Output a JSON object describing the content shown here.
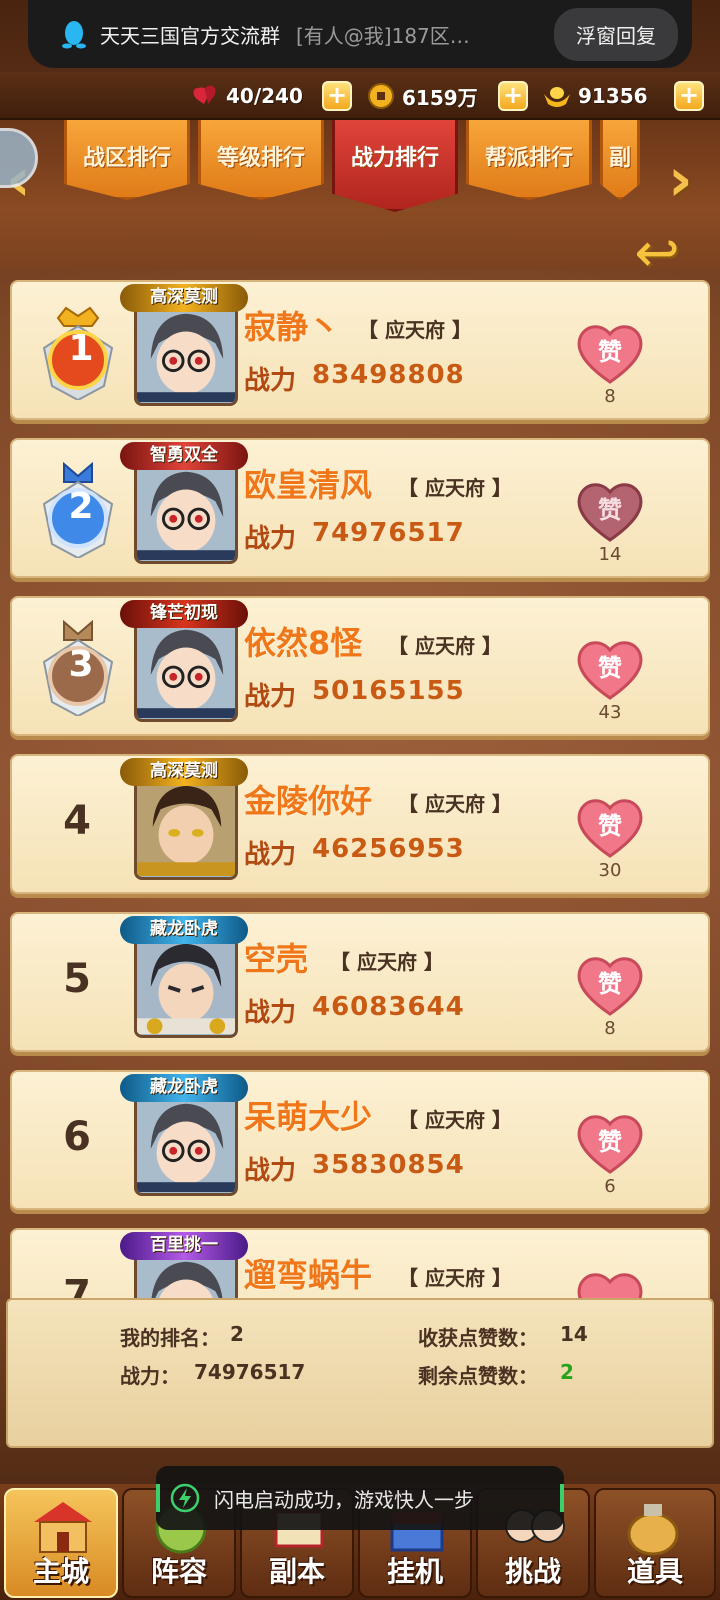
{
  "notification": {
    "app_title": "天天三国官方交流群",
    "message": "[有人@我]187区…",
    "reply_label": "浮窗回复"
  },
  "resources": {
    "stamina": "40/240",
    "copper": "6159万",
    "gold": "91356"
  },
  "tabs": [
    {
      "label": "战区排行",
      "active": false
    },
    {
      "label": "等级排行",
      "active": false
    },
    {
      "label": "战力排行",
      "active": true
    },
    {
      "label": "帮派排行",
      "active": false
    },
    {
      "label": "副",
      "active": false
    }
  ],
  "ranking": [
    {
      "rank": "1",
      "badge": "高深莫测",
      "badge_color": "#c98a18",
      "name": "寂静丶",
      "server": "【 应天府 】",
      "power_label": "战力",
      "power": "83498808",
      "likes": "8",
      "liked": false,
      "avatar": "glasses"
    },
    {
      "rank": "2",
      "badge": "智勇双全",
      "badge_color": "#c0301f",
      "name": "欧皇清风",
      "server": "【 应天府 】",
      "power_label": "战力",
      "power": "74976517",
      "likes": "14",
      "liked": true,
      "avatar": "glasses"
    },
    {
      "rank": "3",
      "badge": "锋芒初现",
      "badge_color": "#b02418",
      "name": "依然8怪",
      "server": "【 应天府 】",
      "power_label": "战力",
      "power": "50165155",
      "likes": "43",
      "liked": false,
      "avatar": "glasses"
    },
    {
      "rank": "4",
      "badge": "高深莫测",
      "badge_color": "#c98a18",
      "name": "金陵你好",
      "server": "【 应天府 】",
      "power_label": "战力",
      "power": "46256953",
      "likes": "30",
      "liked": false,
      "avatar": "warrior"
    },
    {
      "rank": "5",
      "badge": "藏龙卧虎",
      "badge_color": "#2a8cc8",
      "name": "空壳",
      "server": "【 应天府 】",
      "power_label": "战力",
      "power": "46083644",
      "likes": "8",
      "liked": false,
      "avatar": "general"
    },
    {
      "rank": "6",
      "badge": "藏龙卧虎",
      "badge_color": "#2a8cc8",
      "name": "呆萌大少",
      "server": "【 应天府 】",
      "power_label": "战力",
      "power": "35830854",
      "likes": "6",
      "liked": false,
      "avatar": "glasses"
    },
    {
      "rank": "7",
      "badge": "百里挑一",
      "badge_color": "#8a3ad0",
      "name": "遛弯蜗牛",
      "server": "【 应天府 】",
      "power_label": "战力",
      "power": "",
      "likes": "",
      "liked": false,
      "avatar": "glasses"
    }
  ],
  "like_label": "赞",
  "my_info": {
    "rank_label": "我的排名：",
    "rank": "2",
    "power_label": "战力：",
    "power": "74976517",
    "received_label": "收获点赞数：",
    "received": "14",
    "remaining_label": "剩余点赞数：",
    "remaining": "2"
  },
  "toast": "闪电启动成功，游戏快人一步",
  "nav": [
    {
      "label": "主城",
      "active": true
    },
    {
      "label": "阵容",
      "active": false
    },
    {
      "label": "副本",
      "active": false
    },
    {
      "label": "挂机",
      "active": false
    },
    {
      "label": "挑战",
      "active": false
    },
    {
      "label": "道具",
      "active": false
    }
  ]
}
